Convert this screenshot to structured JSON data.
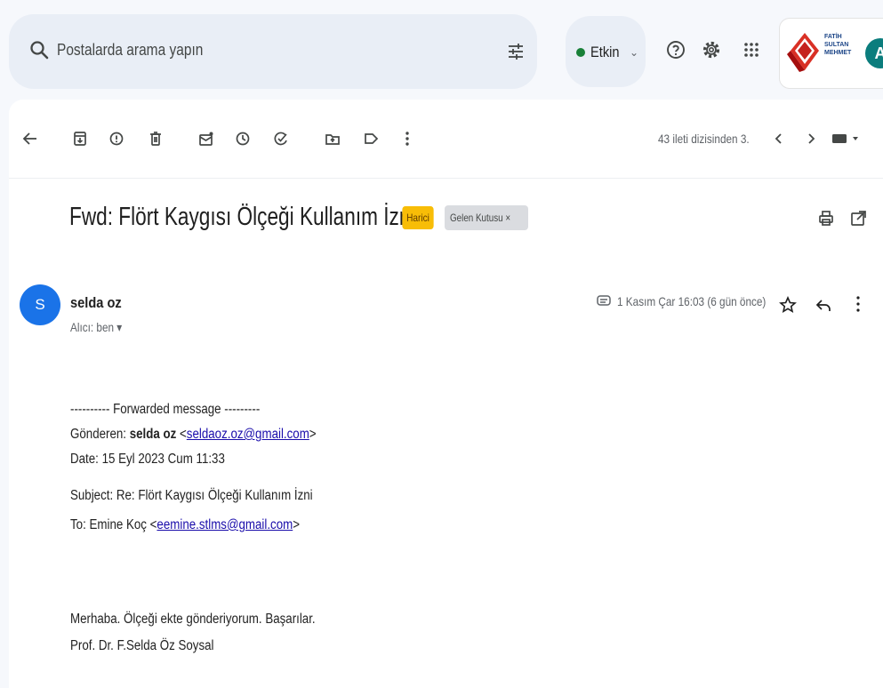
{
  "search": {
    "placeholder": "Postalarda arama yapın"
  },
  "status": {
    "label": "Etkin",
    "color": "#188038"
  },
  "account": {
    "org_logo_text": [
      "FATİH",
      "SULTAN",
      "MEHMET"
    ],
    "avatar_letter": "A"
  },
  "toolbar": {
    "counter": "43 ileti dizisinden 3."
  },
  "email": {
    "subject": "Fwd: Flört Kaygısı Ölçeği Kullanım İzni",
    "labels": {
      "external": "Harici",
      "inbox": "Gelen Kutusu ×"
    },
    "sender_initial": "S",
    "sender_name": "selda oz",
    "recipient": "Alıcı: ben ▾",
    "date": "1 Kasım Çar 16:03 (6 gün önce)",
    "forward_header": "---------- Forwarded message ---------",
    "from_label": "Gönderen:",
    "from_name": "selda oz",
    "from_email": "seldaoz.oz@gmail.com",
    "date_line": "Date: 15 Eyl 2023 Cum 11:33",
    "subject_line": "Subject: Re: Flört Kaygısı Ölçeği Kullanım İzni",
    "to_label": "To: Emine Koç",
    "to_email": "eemine.stlms@gmail.com",
    "message": "Merhaba. Ölçeği ekte gönderiyorum. Başarılar.",
    "signature": "Prof. Dr. F.Selda Öz Soysal"
  }
}
